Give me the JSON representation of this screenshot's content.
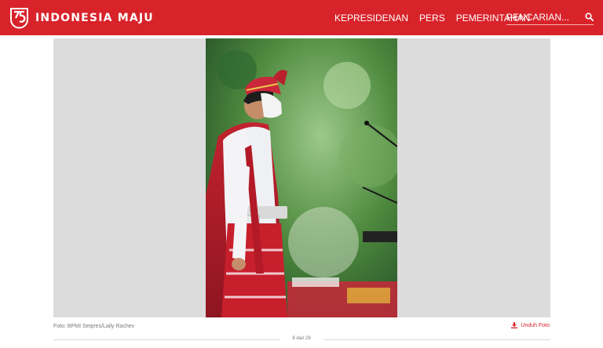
{
  "header": {
    "brand": "INDONESIA MAJU",
    "logo_icon": "indonesia-maju-75-logo-icon",
    "accent_color": "#d8232a"
  },
  "nav": {
    "items": [
      {
        "label": "KEPRESIDENAN"
      },
      {
        "label": "PERS"
      },
      {
        "label": "PEMERINTAHAN"
      }
    ]
  },
  "search": {
    "placeholder": "PENCARIAN...",
    "icon": "search-icon"
  },
  "photo": {
    "caption": "Foto: BPMI Setpres/Laily Rachev",
    "download_label": "Unduh Foto",
    "download_icon": "download-icon"
  },
  "pager": {
    "text": "8 dari 29"
  }
}
